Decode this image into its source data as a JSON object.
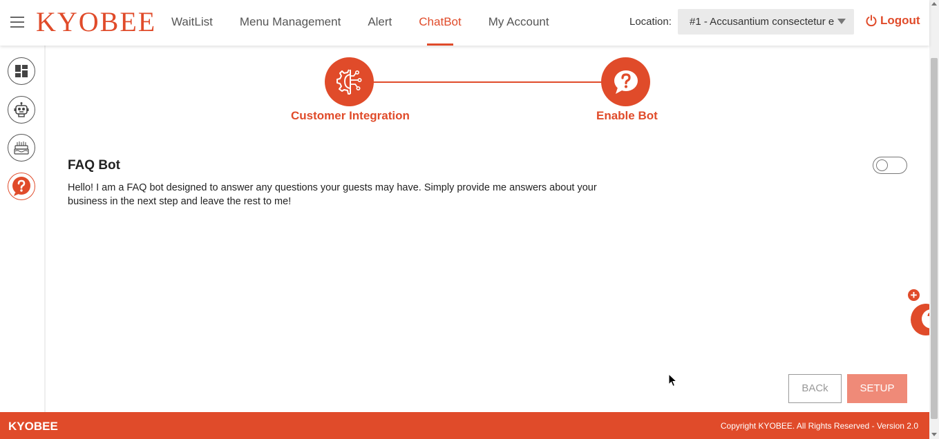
{
  "app": {
    "logo": "KYOBEE"
  },
  "nav": {
    "items": [
      {
        "label": "WaitList"
      },
      {
        "label": "Menu Management"
      },
      {
        "label": "Alert"
      },
      {
        "label": "ChatBot",
        "active": true
      },
      {
        "label": "My Account"
      }
    ]
  },
  "location": {
    "label": "Location:",
    "value": "#1 - Accusantium consectetur e"
  },
  "logout": {
    "label": "Logout"
  },
  "sidebar": {
    "items": [
      {
        "icon": "dashboard-icon"
      },
      {
        "icon": "robot-icon"
      },
      {
        "icon": "cake-icon"
      },
      {
        "icon": "faq-question-icon",
        "active": true
      }
    ]
  },
  "stepper": {
    "steps": [
      {
        "label": "Customer Integration",
        "icon": "integration-icon"
      },
      {
        "label": "Enable Bot",
        "icon": "question-chat-icon"
      }
    ]
  },
  "faq": {
    "title": "FAQ Bot",
    "description": "Hello! I am a FAQ bot designed to answer any questions your guests may have. Simply provide me answers about your business in the next step and leave the rest to me!",
    "enabled": false
  },
  "actions": {
    "back_label": "BACk",
    "setup_label": "SETUP"
  },
  "chat_widget": {
    "plus_label": "+"
  },
  "footer": {
    "brand": "KYOBEE",
    "copyright": "Copyright KYOBEE. All Rights Reserved - Version 2.0"
  },
  "colors": {
    "accent": "#e04b2a",
    "setup_button": "#ef8a78",
    "nav_text": "#555555"
  }
}
